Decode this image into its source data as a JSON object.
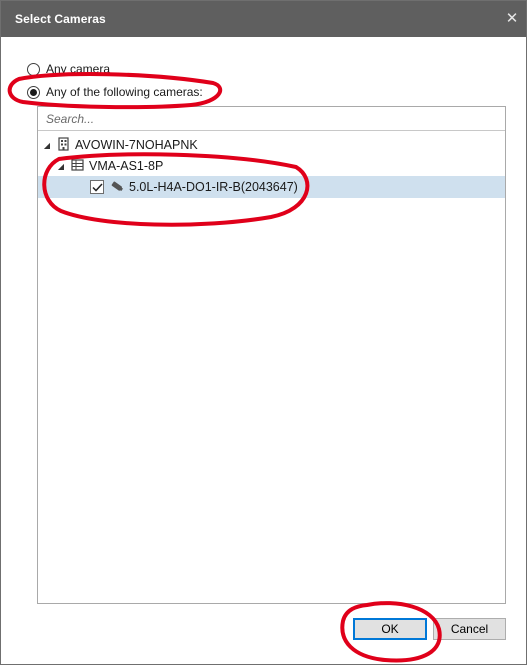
{
  "window": {
    "title": "Select Cameras"
  },
  "options": {
    "any_camera": "Any camera",
    "following_cameras": "Any of the following cameras:"
  },
  "search": {
    "placeholder": "Search..."
  },
  "tree": {
    "server": "AVOWIN-7NOHAPNK",
    "appliance": "VMA-AS1-8P",
    "camera": "5.0L-H4A-DO1-IR-B(2043647)"
  },
  "buttons": {
    "ok": "OK",
    "cancel": "Cancel"
  },
  "colors": {
    "titlebar": "#5f5f5f",
    "selection": "#cfe0ee",
    "annotation": "#e0001a",
    "default_button_border": "#0078d7"
  }
}
